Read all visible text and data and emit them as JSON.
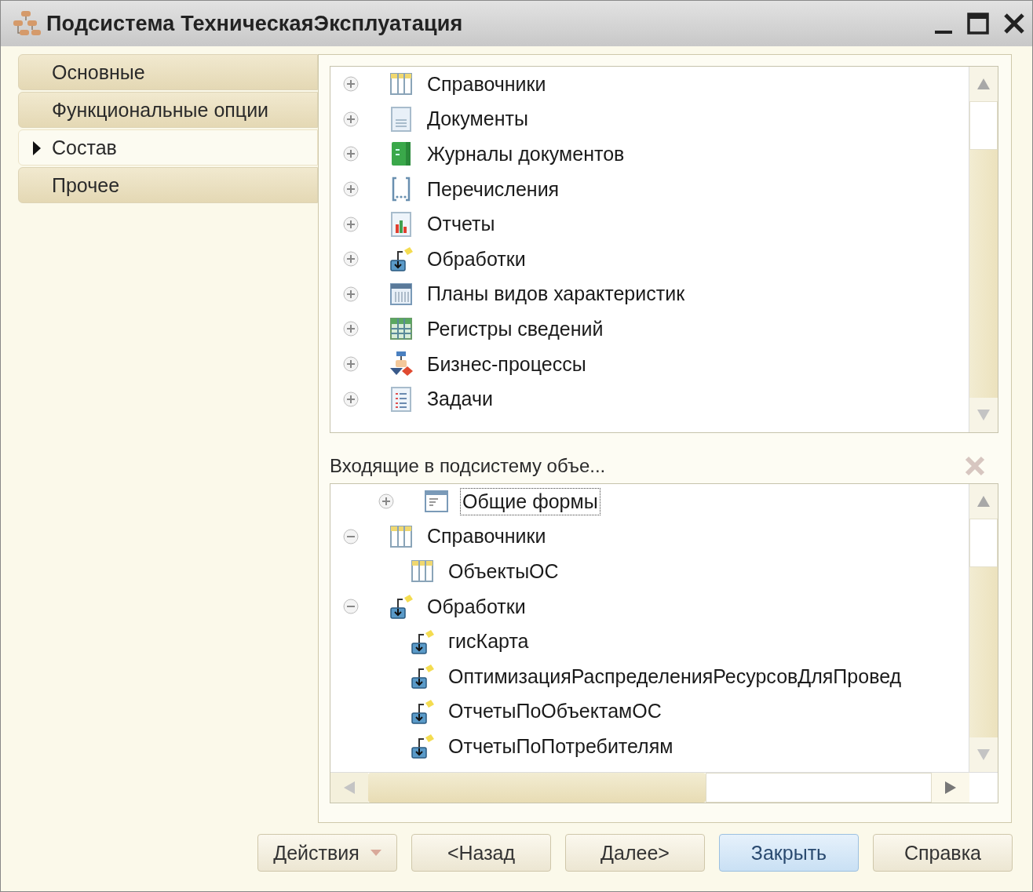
{
  "window": {
    "title": "Подсистема ТехническаяЭксплуатация"
  },
  "tabs": [
    {
      "label": "Основные",
      "selected": false
    },
    {
      "label": "Функциональные опции",
      "selected": false
    },
    {
      "label": "Состав",
      "selected": true
    },
    {
      "label": "Прочее",
      "selected": false
    }
  ],
  "object_types": [
    {
      "label": "Справочники",
      "kind": "catalog",
      "expanded": false
    },
    {
      "label": "Документы",
      "kind": "document",
      "expanded": false
    },
    {
      "label": "Журналы документов",
      "kind": "journal",
      "expanded": false
    },
    {
      "label": "Перечисления",
      "kind": "enum",
      "expanded": false
    },
    {
      "label": "Отчеты",
      "kind": "report",
      "expanded": false
    },
    {
      "label": "Обработки",
      "kind": "processing",
      "expanded": false
    },
    {
      "label": "Планы видов характеристик",
      "kind": "chart",
      "expanded": false
    },
    {
      "label": "Регистры сведений",
      "kind": "register",
      "expanded": false
    },
    {
      "label": "Бизнес-процессы",
      "kind": "bprocess",
      "expanded": false
    },
    {
      "label": "Задачи",
      "kind": "task",
      "expanded": false
    }
  ],
  "included": {
    "title": "Входящие в подсистему объе...",
    "scrolled_parent_children": [
      {
        "label": "Общие формы",
        "kind": "form",
        "expanded": false,
        "selected": true
      }
    ],
    "items": [
      {
        "label": "Справочники",
        "kind": "catalog",
        "expanded": true,
        "selected": false,
        "children": [
          {
            "label": "ОбъектыОС",
            "kind": "catalog",
            "selected": false
          }
        ]
      },
      {
        "label": "Обработки",
        "kind": "processing",
        "expanded": true,
        "selected": false,
        "children": [
          {
            "label": "гисКарта",
            "kind": "processing",
            "selected": false
          },
          {
            "label": "ОптимизацияРаспределенияРесурсовДляПровед",
            "kind": "processing",
            "selected": false
          },
          {
            "label": "ОтчетыПоОбъектамОС",
            "kind": "processing",
            "selected": false
          },
          {
            "label": "ОтчетыПоПотребителям",
            "kind": "processing",
            "selected": false
          }
        ]
      }
    ]
  },
  "buttons": [
    {
      "label": "Действия",
      "kind": "menu",
      "default": false
    },
    {
      "label": "<Назад",
      "kind": "plain",
      "default": false
    },
    {
      "label": "Далее>",
      "kind": "plain",
      "default": false
    },
    {
      "label": "Закрыть",
      "kind": "plain",
      "default": true
    },
    {
      "label": "Справка",
      "kind": "plain",
      "default": false
    }
  ]
}
